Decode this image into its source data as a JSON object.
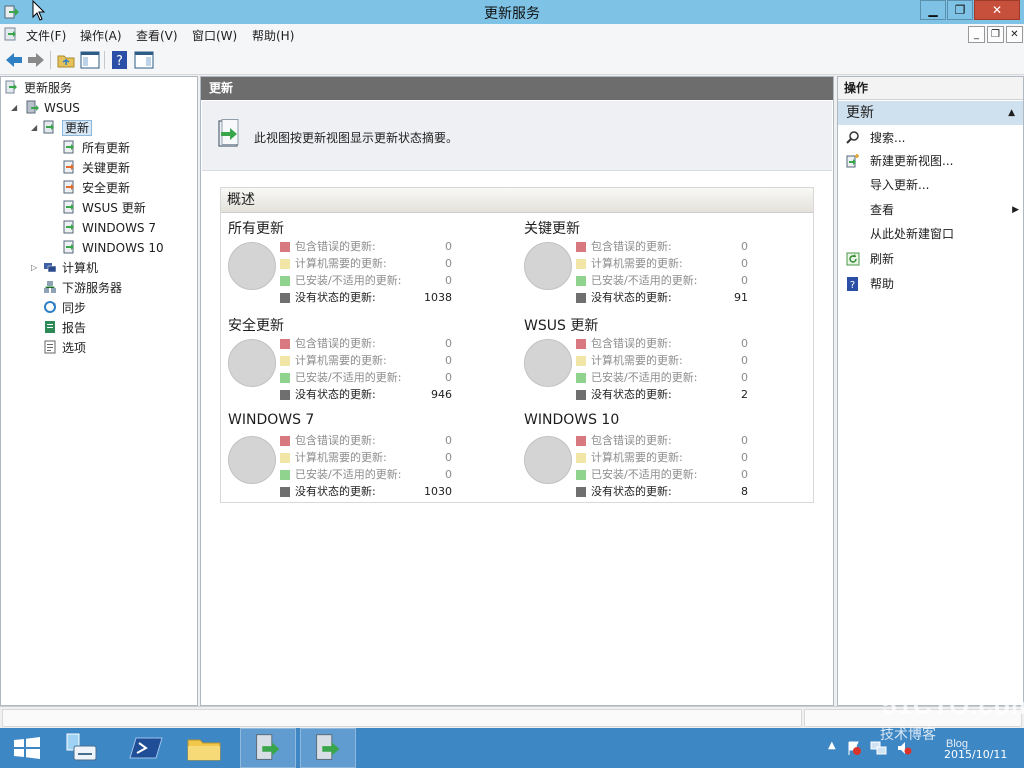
{
  "window": {
    "title": "更新服务"
  },
  "menu": [
    "文件(F)",
    "操作(A)",
    "查看(V)",
    "窗口(W)",
    "帮助(H)"
  ],
  "tree": {
    "root": "更新服务",
    "server": "WSUS",
    "updates": "更新",
    "children": [
      "所有更新",
      "关键更新",
      "安全更新",
      "WSUS 更新",
      "WINDOWS 7",
      "WINDOWS 10"
    ],
    "computers": "计算机",
    "downstream": "下游服务器",
    "sync": "同步",
    "reports": "报告",
    "options": "选项"
  },
  "center": {
    "header": "更新",
    "description": "此视图按更新视图显示更新状态摘要。",
    "overview_title": "概述",
    "status_labels": [
      "包含错误的更新:",
      "计算机需要的更新:",
      "已安装/不适用的更新:",
      "没有状态的更新:"
    ],
    "status_colors": [
      "#d7797f",
      "#f2e6a6",
      "#8fd38f",
      "#6f6f6f"
    ],
    "groups": [
      {
        "title": "所有更新",
        "counts": [
          "0",
          "0",
          "0",
          "1038"
        ]
      },
      {
        "title": "关键更新",
        "counts": [
          "0",
          "0",
          "0",
          "91"
        ]
      },
      {
        "title": "安全更新",
        "counts": [
          "0",
          "0",
          "0",
          "946"
        ]
      },
      {
        "title": "WSUS 更新",
        "counts": [
          "0",
          "0",
          "0",
          "2"
        ]
      },
      {
        "title": "WINDOWS 7",
        "counts": [
          "0",
          "0",
          "0",
          "1030"
        ]
      },
      {
        "title": "WINDOWS 10",
        "counts": [
          "0",
          "0",
          "0",
          "8"
        ]
      }
    ]
  },
  "actions": {
    "header": "操作",
    "section": "更新",
    "items": [
      "搜索...",
      "新建更新视图...",
      "导入更新...",
      "查看",
      "从此处新建窗口",
      "刷新",
      "帮助"
    ]
  },
  "taskbar": {
    "date": "2015/10/11"
  },
  "watermark": {
    "line1": "51CTO.com",
    "line2": "技术博客",
    "line3": "Blog"
  }
}
